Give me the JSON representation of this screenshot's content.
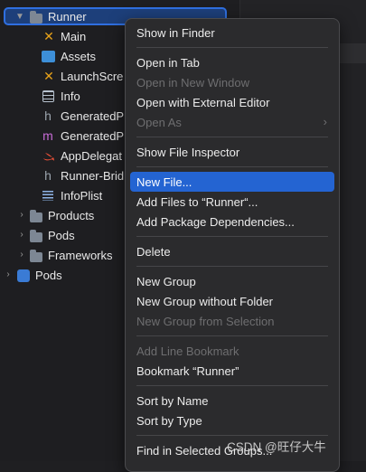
{
  "navigator": {
    "items": [
      {
        "label": "Runner",
        "icon": "folder-icon",
        "disclosure": "expanded"
      },
      {
        "label": "Main",
        "icon": "interface-builder-icon"
      },
      {
        "label": "Assets",
        "icon": "asset-catalog-icon"
      },
      {
        "label": "LaunchScre",
        "icon": "interface-builder-icon"
      },
      {
        "label": "Info",
        "icon": "plist-icon"
      },
      {
        "label": "GeneratedP",
        "icon": "header-file-icon"
      },
      {
        "label": "GeneratedP",
        "icon": "objc-file-icon"
      },
      {
        "label": "AppDelegat",
        "icon": "swift-file-icon"
      },
      {
        "label": "Runner-Brid",
        "icon": "header-file-icon"
      },
      {
        "label": "InfoPlist",
        "icon": "strings-file-icon"
      },
      {
        "label": "Products",
        "icon": "folder-icon",
        "disclosure": "collapsed"
      },
      {
        "label": "Pods",
        "icon": "folder-icon",
        "disclosure": "collapsed"
      },
      {
        "label": "Frameworks",
        "icon": "folder-icon",
        "disclosure": "collapsed"
      },
      {
        "label": "Pods",
        "icon": "project-icon",
        "disclosure": "collapsed"
      }
    ]
  },
  "menu": {
    "items": [
      {
        "label": "Show in Finder",
        "enabled": true
      },
      {
        "label": "Open in Tab",
        "enabled": true
      },
      {
        "label": "Open in New Window",
        "enabled": false
      },
      {
        "label": "Open with External Editor",
        "enabled": true
      },
      {
        "label": "Open As",
        "enabled": false,
        "submenu": "›"
      },
      {
        "label": "Show File Inspector",
        "enabled": true
      },
      {
        "label": "New File...",
        "enabled": true,
        "highlighted": true
      },
      {
        "label": "Add Files to “Runner“...",
        "enabled": true
      },
      {
        "label": "Add Package Dependencies...",
        "enabled": true
      },
      {
        "label": "Delete",
        "enabled": true
      },
      {
        "label": "New Group",
        "enabled": true
      },
      {
        "label": "New Group without Folder",
        "enabled": true
      },
      {
        "label": "New Group from Selection",
        "enabled": false
      },
      {
        "label": "Add Line Bookmark",
        "enabled": false
      },
      {
        "label": "Bookmark “Runner”",
        "enabled": true
      },
      {
        "label": "Sort by Name",
        "enabled": true
      },
      {
        "label": "Sort by Type",
        "enabled": true
      },
      {
        "label": "Find in Selected Groups...",
        "enabled": true
      }
    ]
  },
  "watermark": "CSDN @旺仔大牛",
  "colors": {
    "accent": "#2464d2",
    "selection_border": "#2f6fe0"
  }
}
